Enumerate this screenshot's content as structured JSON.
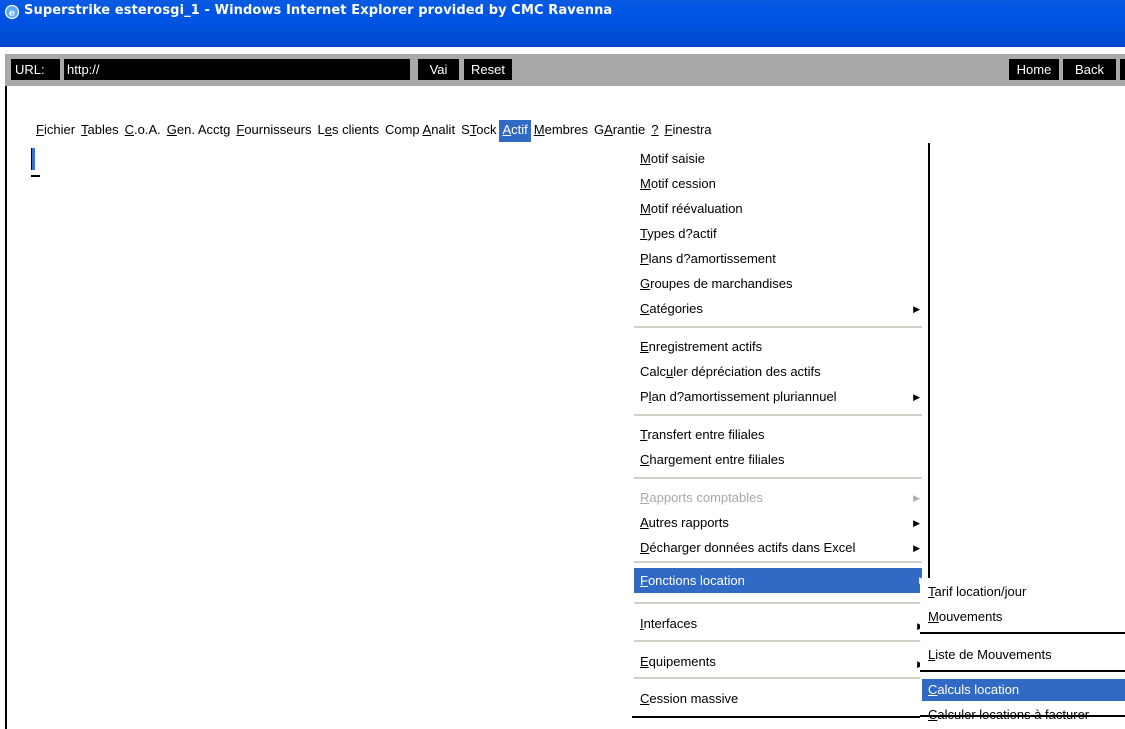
{
  "window": {
    "title": "Superstrike esterosgi_1 - Windows Internet Explorer provided by CMC Ravenna",
    "title_bar_color": "#0054e3"
  },
  "toolbar": {
    "url_label": "URL:",
    "url_value": "http://",
    "vai_label": "Vai",
    "reset_label": "Reset",
    "home_label": "Home",
    "back_label": "Back"
  },
  "menubar": {
    "items": [
      {
        "pre": "",
        "u": "F",
        "post": "ichier"
      },
      {
        "pre": "",
        "u": "T",
        "post": "ables"
      },
      {
        "pre": "",
        "u": "C",
        "post": ".o.A."
      },
      {
        "pre": "",
        "u": "G",
        "post": "en. Acctg"
      },
      {
        "pre": "",
        "u": "F",
        "post": "ournisseurs"
      },
      {
        "pre": "L",
        "u": "e",
        "post": "s clients"
      },
      {
        "pre": "Comp ",
        "u": "A",
        "post": "nalit"
      },
      {
        "pre": "S",
        "u": "T",
        "post": "ock"
      },
      {
        "pre": "",
        "u": "A",
        "post": "ctif"
      },
      {
        "pre": "",
        "u": "M",
        "post": "embres"
      },
      {
        "pre": "G",
        "u": "A",
        "post": "rantie"
      },
      {
        "pre": "",
        "u": "?",
        "post": ""
      },
      {
        "pre": "",
        "u": "F",
        "post": "inestra"
      }
    ],
    "active_index": 8,
    "active_color": "#316ac5"
  },
  "dropdown": {
    "items": [
      {
        "pre": "",
        "u": "M",
        "post": "otif saisie"
      },
      {
        "pre": "",
        "u": "M",
        "post": "otif cession"
      },
      {
        "pre": "",
        "u": "M",
        "post": "otif réévaluation"
      },
      {
        "pre": "",
        "u": "T",
        "post": "ypes d?actif"
      },
      {
        "pre": "",
        "u": "P",
        "post": "lans d?amortissement"
      },
      {
        "pre": "",
        "u": "G",
        "post": "roupes de marchandises"
      },
      {
        "pre": "",
        "u": "C",
        "post": "atégories"
      },
      {
        "pre": "",
        "u": "E",
        "post": "nregistrement actifs"
      },
      {
        "pre": "Calc",
        "u": "u",
        "post": "ler dépréciation des actifs"
      },
      {
        "pre": "P",
        "u": "l",
        "post": "an d?amortissement pluriannuel"
      },
      {
        "pre": "",
        "u": "T",
        "post": "ransfert entre filiales"
      },
      {
        "pre": "",
        "u": "C",
        "post": "hargement entre filiales"
      },
      {
        "pre": "",
        "u": "R",
        "post": "apports comptables"
      },
      {
        "pre": "",
        "u": "A",
        "post": "utres rapports"
      },
      {
        "pre": "",
        "u": "D",
        "post": "écharger données actifs dans Excel"
      },
      {
        "pre": "",
        "u": "F",
        "post": "onctions location"
      },
      {
        "pre": "",
        "u": "I",
        "post": "nterfaces"
      },
      {
        "pre": "",
        "u": "E",
        "post": "quipements"
      },
      {
        "pre": "",
        "u": "C",
        "post": "ession massive"
      }
    ]
  },
  "submenu": {
    "items": [
      {
        "pre": "",
        "u": "T",
        "post": "arif location/jour"
      },
      {
        "pre": "",
        "u": "M",
        "post": "ouvements"
      },
      {
        "pre": "",
        "u": "L",
        "post": "iste de Mouvements"
      },
      {
        "pre": "",
        "u": "C",
        "post": "alculs location"
      },
      {
        "pre": "",
        "u": "C",
        "post": "alculer locations à facturer"
      }
    ],
    "selected_index": 3
  }
}
